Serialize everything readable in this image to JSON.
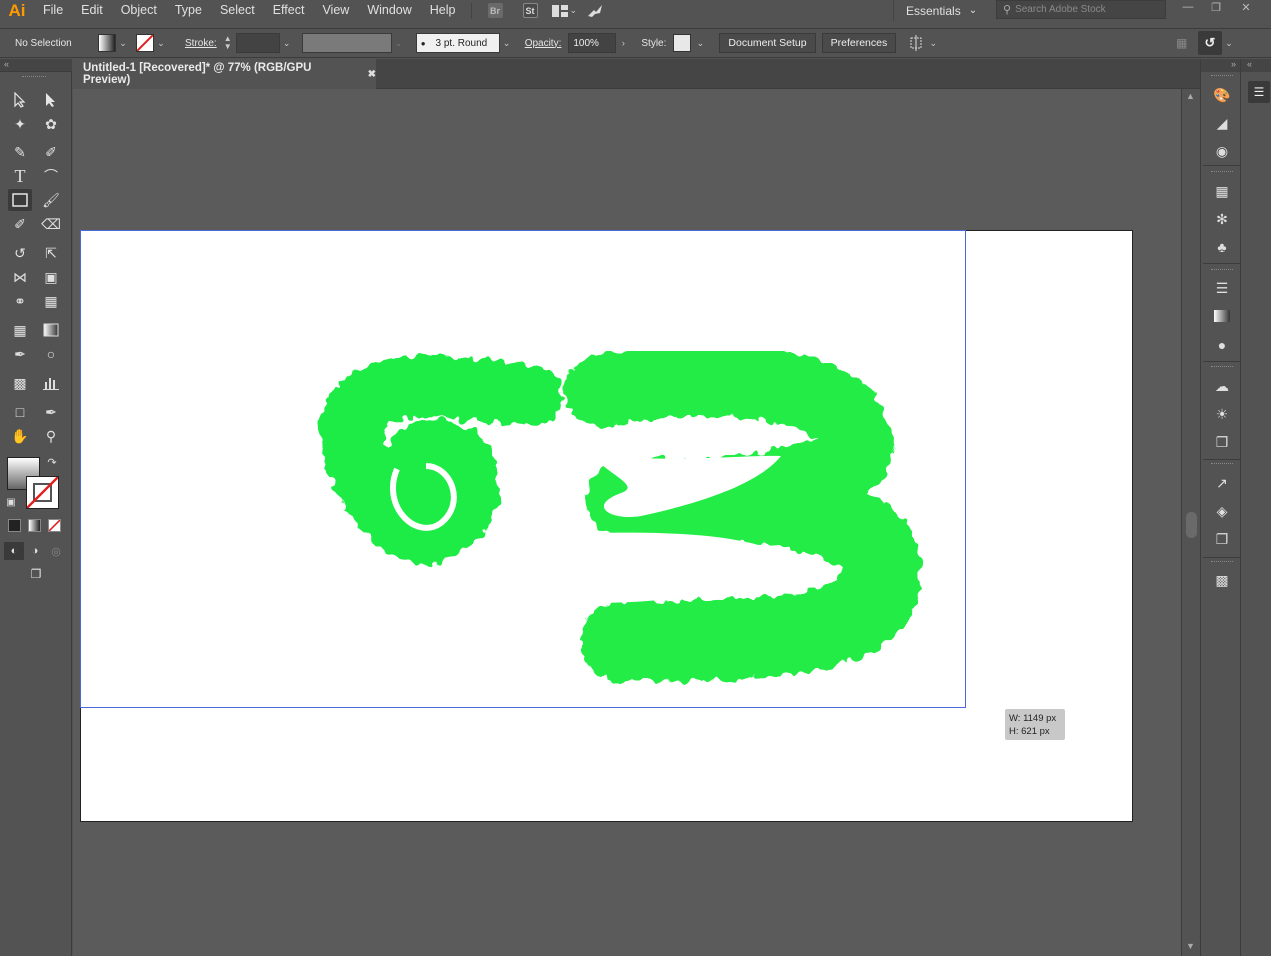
{
  "app": {
    "logo": "Ai"
  },
  "menu": [
    "File",
    "Edit",
    "Object",
    "Type",
    "Select",
    "Effect",
    "View",
    "Window",
    "Help"
  ],
  "menubar_badges": {
    "bridge": "Br",
    "stock": "St"
  },
  "workspace": {
    "label": "Essentials"
  },
  "search": {
    "placeholder": "Search Adobe Stock"
  },
  "control_bar": {
    "selection": "No Selection",
    "stroke_label": "Stroke:",
    "brush": "3 pt. Round",
    "opacity_label": "Opacity:",
    "opacity_value": "100%",
    "style_label": "Style:",
    "document_setup": "Document Setup",
    "preferences": "Preferences"
  },
  "document": {
    "tab_title": "Untitled-1 [Recovered]* @ 77% (RGB/GPU Preview)"
  },
  "dimension_tooltip": {
    "w": "W: 1149 px",
    "h": "H: 621 px"
  },
  "colors": {
    "ui_bg": "#535353",
    "canvas": "#5b5b5b",
    "artboard": "#ffffff",
    "art_green": "#22ee44",
    "selection": "#4a6bd6",
    "logo": "#ff9a00"
  }
}
